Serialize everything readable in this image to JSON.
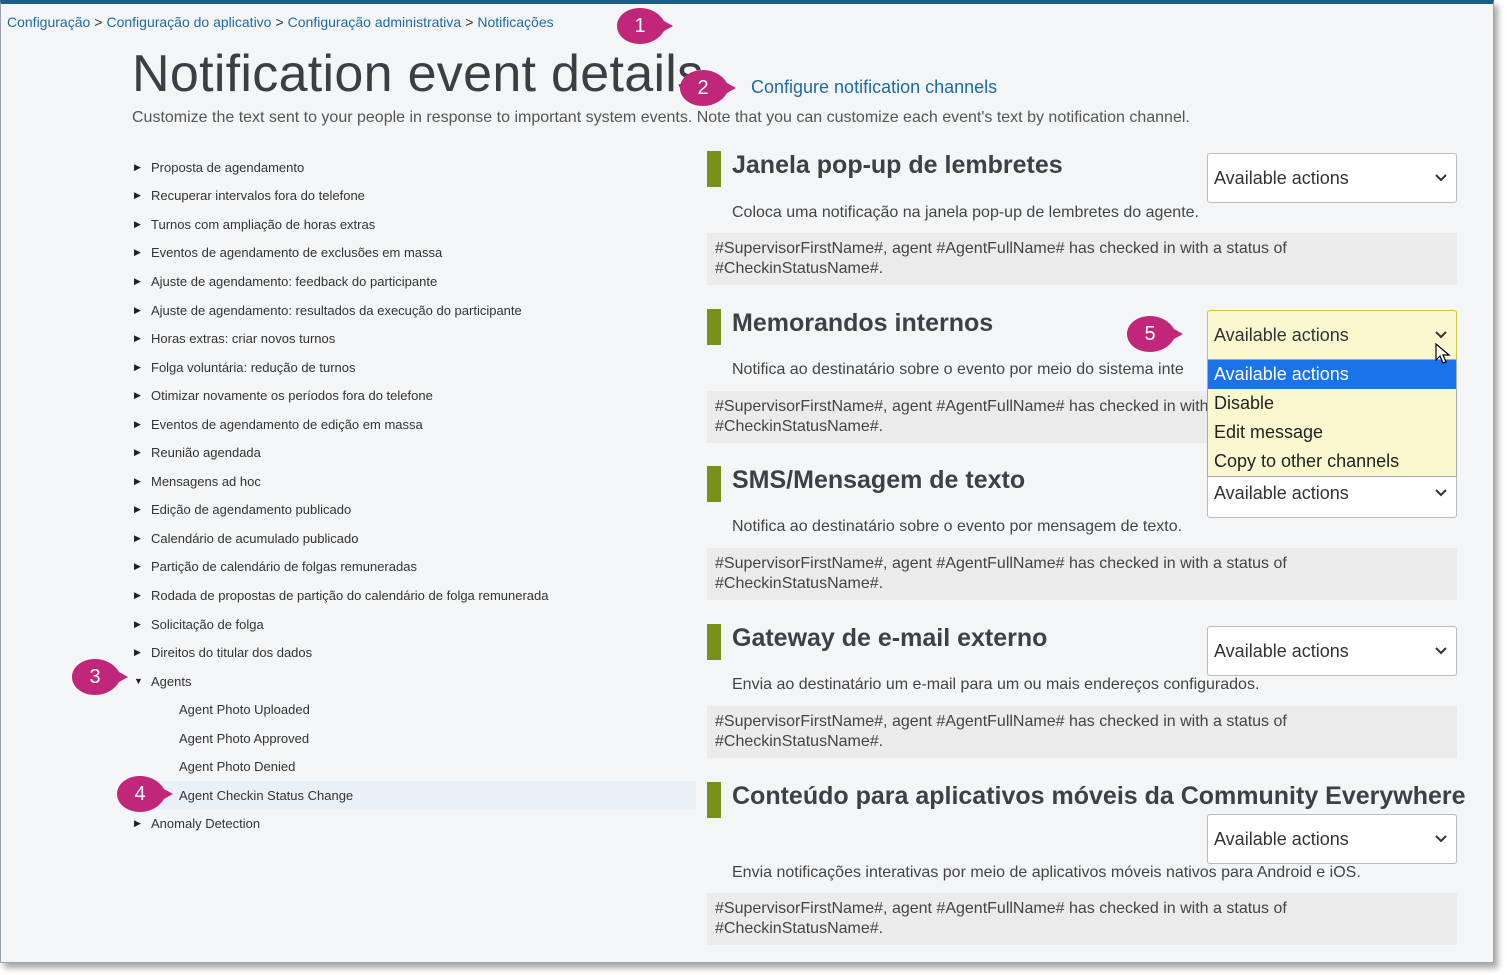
{
  "breadcrumb": [
    {
      "label": "Configuração"
    },
    {
      "label": "Configuração do aplicativo"
    },
    {
      "label": "Configuração administrativa"
    },
    {
      "label": "Notificações"
    }
  ],
  "breadcrumb_separator": ">",
  "header": {
    "title": "Notification event details",
    "config_link": "Configure notification channels",
    "subtitle": "Customize the text sent to your people in response to important system events. Note that you can customize each event's text by notification channel."
  },
  "tree": {
    "items": [
      {
        "label": "Proposta de agendamento",
        "expanded": false
      },
      {
        "label": "Recuperar intervalos fora do telefone",
        "expanded": false
      },
      {
        "label": "Turnos com ampliação de horas extras",
        "expanded": false
      },
      {
        "label": "Eventos de agendamento de exclusões em massa",
        "expanded": false
      },
      {
        "label": "Ajuste de agendamento: feedback do participante",
        "expanded": false
      },
      {
        "label": "Ajuste de agendamento: resultados da execução do participante",
        "expanded": false
      },
      {
        "label": "Horas extras: criar novos turnos",
        "expanded": false
      },
      {
        "label": "Folga voluntária: redução de turnos",
        "expanded": false
      },
      {
        "label": "Otimizar novamente os períodos fora do telefone",
        "expanded": false
      },
      {
        "label": "Eventos de agendamento de edição em massa",
        "expanded": false
      },
      {
        "label": "Reunião agendada",
        "expanded": false
      },
      {
        "label": "Mensagens ad hoc",
        "expanded": false
      },
      {
        "label": "Edição de agendamento publicado",
        "expanded": false
      },
      {
        "label": "Calendário de acumulado publicado",
        "expanded": false
      },
      {
        "label": "Partição de calendário de folgas remuneradas",
        "expanded": false
      },
      {
        "label": "Rodada de propostas de partição do calendário de folga remunerada",
        "expanded": false
      },
      {
        "label": "Solicitação de folga",
        "expanded": false
      },
      {
        "label": "Direitos do titular dos dados",
        "expanded": false
      },
      {
        "label": "Agents",
        "expanded": true
      }
    ],
    "agents_children": [
      {
        "label": "Agent Photo Uploaded",
        "selected": false
      },
      {
        "label": "Agent Photo Approved",
        "selected": false
      },
      {
        "label": "Agent Photo Denied",
        "selected": false
      },
      {
        "label": "Agent Checkin Status Change",
        "selected": true
      }
    ],
    "last_item": {
      "label": "Anomaly Detection",
      "expanded": false
    }
  },
  "message_line1": "#SupervisorFirstName#, agent #AgentFullName# has checked in with a status of",
  "message_line2": "#CheckinStatusName#.",
  "select_label": "Available actions",
  "panels": [
    {
      "title": "Janela pop-up de lembretes",
      "desc": "Coloca uma notificação na janela pop-up de lembretes do agente.",
      "select": "Available actions"
    },
    {
      "title": "Memorandos internos",
      "desc": "Notifica ao destinatário sobre o evento por meio do sistema inte",
      "select": "Available actions",
      "open": true
    },
    {
      "title": "SMS/Mensagem de texto",
      "desc": "Notifica ao destinatário sobre o evento por mensagem de texto.",
      "select": "Available actions"
    },
    {
      "title": "Gateway de e-mail externo",
      "desc": "Envia ao destinatário um e-mail para um ou mais endereços configurados.",
      "select": "Available actions"
    },
    {
      "title": "Conteúdo para aplicativos móveis da Community Everywhere",
      "desc": "Envia notificações interativas por meio de aplicativos móveis nativos para Android e iOS.",
      "select": "Available actions"
    }
  ],
  "dropdown_options": [
    "Available actions",
    "Disable",
    "Edit message",
    "Copy to other channels"
  ],
  "callouts": [
    "1",
    "2",
    "3",
    "4",
    "5"
  ],
  "colors": {
    "accent_bar": "#7a8f18",
    "link": "#1d6aa5",
    "callout": "#c0267a",
    "dropdown_active": "#1a73e8",
    "dropdown_bg": "#fbf8cf"
  }
}
